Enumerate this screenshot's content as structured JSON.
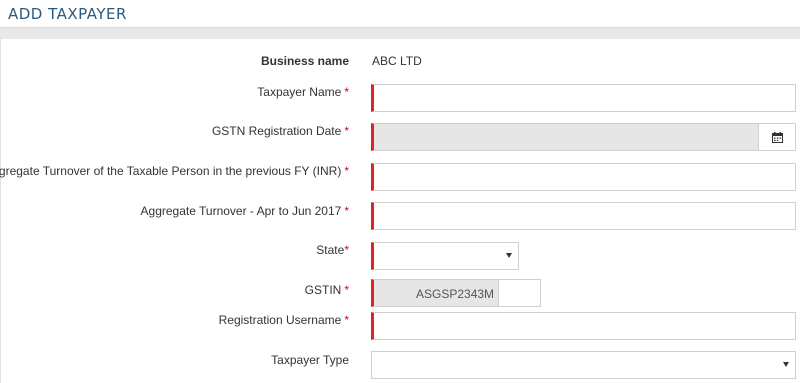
{
  "header": {
    "title": "ADD TAXPAYER"
  },
  "form": {
    "business_name": {
      "label": "Business name",
      "value": "ABC LTD"
    },
    "taxpayer_name": {
      "label": "Taxpayer Name",
      "required": "*",
      "value": ""
    },
    "gstn_registration_date": {
      "label": "GSTN Registration Date",
      "required": "*",
      "value": "",
      "icon": "calendar-icon"
    },
    "aggregate_turnover_prev_fy": {
      "label": "Aggregate Turnover of the Taxable Person in the previous FY (INR)",
      "required": "*",
      "value": ""
    },
    "aggregate_turnover_apr_jun": {
      "label": "Aggregate Turnover - Apr to Jun 2017",
      "required": "*",
      "value": ""
    },
    "state": {
      "label": "State",
      "required": "*",
      "selected": "",
      "icon": "caret-down-icon"
    },
    "gstin": {
      "label": "GSTIN",
      "required": "*",
      "value": "ASGSP2343M"
    },
    "registration_username": {
      "label": "Registration Username",
      "required": "*",
      "value": ""
    },
    "taxpayer_type": {
      "label": "Taxpayer Type",
      "selected": "",
      "icon": "caret-down-icon"
    }
  },
  "colors": {
    "title": "#2b5a80",
    "required_marker": "#e02424",
    "disabled_field": "#e6e6e6"
  }
}
